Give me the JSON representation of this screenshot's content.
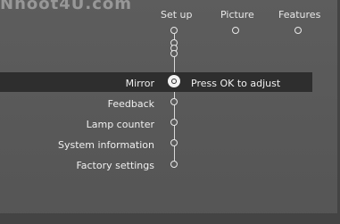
{
  "watermark": "Nhoot4U.com",
  "tabs": [
    {
      "label": "Set up"
    },
    {
      "label": "Picture"
    },
    {
      "label": "Features"
    }
  ],
  "menu": {
    "items": [
      {
        "label": "Mirror",
        "selected": true
      },
      {
        "label": "Feedback"
      },
      {
        "label": "Lamp counter"
      },
      {
        "label": "System information"
      },
      {
        "label": "Factory settings"
      }
    ],
    "hint": "Press OK to adjust"
  },
  "colors": {
    "background": "#5a5a5a",
    "selection_bar": "#2e2e2e",
    "text": "#f0f0f0"
  }
}
